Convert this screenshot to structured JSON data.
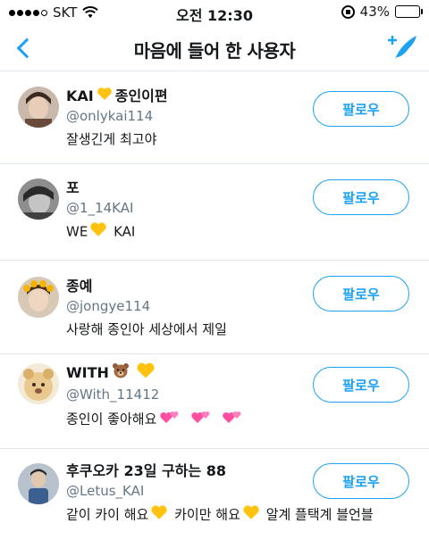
{
  "status_bar": {
    "carrier": "SKT",
    "signal_bars": 4,
    "time": "오전 12:30",
    "battery_percent": "43%",
    "battery_level": 0.43
  },
  "nav": {
    "title": "마음에 들어 한 사용자",
    "back_icon": "chevron-left-icon",
    "add_icon": "add-feather-icon"
  },
  "colors": {
    "accent": "#1da1f2",
    "handle": "#657786",
    "divider": "#e1e8ed",
    "battery": "#f5c51a"
  },
  "users": [
    {
      "name_pre": "KAI",
      "name_post": "종인이편",
      "handle": "@onlykai114",
      "bio_parts": [
        "잘생긴게 최고야"
      ],
      "follow_label": "팔로우"
    },
    {
      "name_pre": "포",
      "name_post": "",
      "handle": "@1_14KAI",
      "bio_parts": [
        "WE",
        "KAI"
      ],
      "follow_label": "팔로우"
    },
    {
      "name_pre": "종예",
      "name_post": "",
      "handle": "@jongye114",
      "bio_parts": [
        "사랑해 종인아 세상에서 제일"
      ],
      "follow_label": "팔로우"
    },
    {
      "name_pre": "WITH",
      "name_post": "",
      "handle": "@With_11412",
      "bio_parts": [
        "종인이 좋아해요"
      ],
      "follow_label": "팔로우"
    },
    {
      "name_pre": "후쿠오카 23일 구하는 88",
      "name_post": "",
      "handle": "@Letus_KAI",
      "bio_parts": [
        "같이 카이 해요",
        "카이만 해요",
        "알계 플택계 블언블"
      ],
      "follow_label": "팔로우"
    }
  ]
}
